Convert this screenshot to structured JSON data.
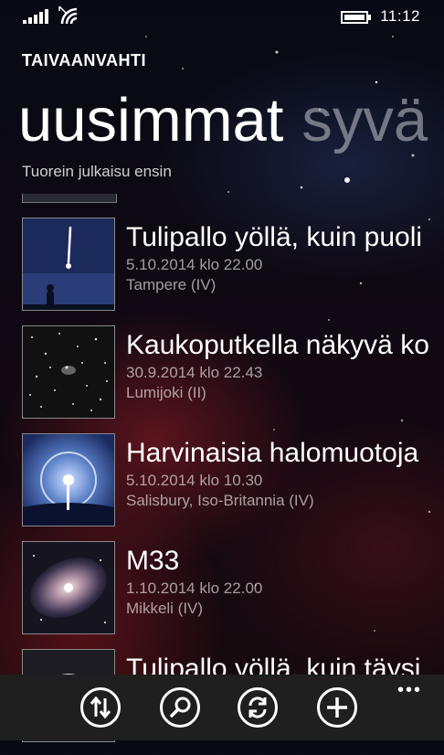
{
  "status": {
    "time": "11:12"
  },
  "app": {
    "title": "TAIVAANVAHTI"
  },
  "pivot": {
    "active": "uusimmat",
    "next": "syvä"
  },
  "subtitle": "Tuorein julkaisu ensin",
  "items": [
    {
      "title": "Tulipallo yöllä, kuin puoli",
      "date": "5.10.2014 klo 22.00",
      "location": "Tampere (IV)"
    },
    {
      "title": "Kaukoputkella näkyvä ko",
      "date": "30.9.2014 klo 22.43",
      "location": "Lumijoki (II)"
    },
    {
      "title": "Harvinaisia halomuotoja",
      "date": "5.10.2014 klo 10.30",
      "location": "Salisbury, Iso-Britannia (IV)"
    },
    {
      "title": "M33",
      "date": "1.10.2014 klo 22.00",
      "location": "Mikkeli (IV)"
    },
    {
      "title": "Tulipallo yöllä, kuin täysi",
      "date": "",
      "location": ""
    }
  ],
  "appbar": {
    "more": "•••",
    "buttons": [
      "sort-icon",
      "search-icon",
      "refresh-icon",
      "add-icon"
    ]
  }
}
